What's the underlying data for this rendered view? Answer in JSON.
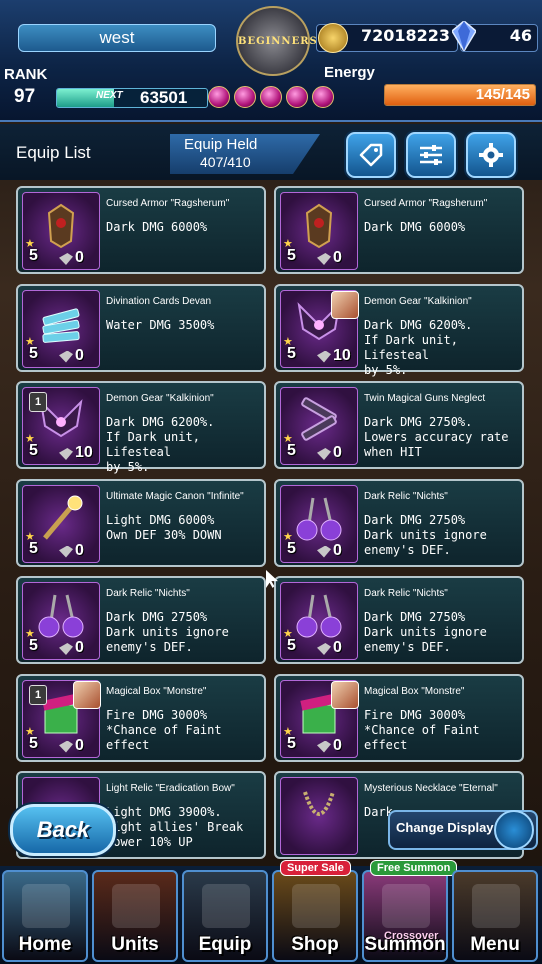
{
  "player": {
    "name": "west",
    "rank_label": "RANK",
    "rank": "97",
    "next_label": "NEXT",
    "next_exp": "63501",
    "exp_fraction": 0.38
  },
  "emblem": {
    "text": "BEGINNERS"
  },
  "currency": {
    "gold": "72018223",
    "gems": "46"
  },
  "energy": {
    "label": "Energy",
    "value": "145/145",
    "fraction": 1.0
  },
  "header": {
    "title": "Equip List",
    "held_label": "Equip Held",
    "held_value": "407/410",
    "buttons": [
      {
        "icon": "tag-icon"
      },
      {
        "icon": "filter-sliders-icon"
      },
      {
        "icon": "gear-icon"
      }
    ]
  },
  "cards": [
    {
      "name": "Cursed Armor \"Ragsherum\"",
      "desc": "Dark DMG 6000%",
      "level": "5",
      "count": "0",
      "art": "armor"
    },
    {
      "name": "Cursed Armor \"Ragsherum\"",
      "desc": "Dark DMG 6000%",
      "level": "5",
      "count": "0",
      "art": "armor"
    },
    {
      "name": "Divination Cards Devan",
      "desc": "Water DMG 3500%",
      "level": "5",
      "count": "0",
      "art": "cards"
    },
    {
      "name": "Demon Gear \"Kalkinion\"",
      "desc": "Dark DMG 6200%.\nIf Dark unit, Lifesteal\nby 5%.",
      "level": "5",
      "count": "10",
      "art": "wings",
      "portrait": true
    },
    {
      "name": "Demon Gear \"Kalkinion\"",
      "desc": "Dark DMG 6200%.\nIf Dark unit, Lifesteal\nby 5%.",
      "level": "5",
      "count": "10",
      "art": "wings",
      "badge": "1"
    },
    {
      "name": "Twin Magical Guns Neglect",
      "desc": "Dark DMG 2750%.\nLowers accuracy rate\nwhen HIT",
      "level": "5",
      "count": "0",
      "art": "guns"
    },
    {
      "name": "Ultimate Magic Canon \"Infinite\"",
      "desc": "Light DMG 6000%\nOwn DEF 30% DOWN",
      "level": "5",
      "count": "0",
      "art": "staff"
    },
    {
      "name": "Dark Relic \"Nichts\"",
      "desc": "Dark DMG 2750%\nDark units ignore\nenemy's DEF.",
      "level": "5",
      "count": "0",
      "art": "relic"
    },
    {
      "name": "Dark Relic \"Nichts\"",
      "desc": "Dark DMG 2750%\nDark units ignore\nenemy's DEF.",
      "level": "5",
      "count": "0",
      "art": "relic"
    },
    {
      "name": "Dark Relic \"Nichts\"",
      "desc": "Dark DMG 2750%\nDark units ignore\nenemy's DEF.",
      "level": "5",
      "count": "0",
      "art": "relic"
    },
    {
      "name": "Magical Box \"Monstre\"",
      "desc": "Fire DMG 3000%\n*Chance of Faint\neffect",
      "level": "5",
      "count": "0",
      "art": "box",
      "badge": "1",
      "portrait": true
    },
    {
      "name": "Magical Box \"Monstre\"",
      "desc": "Fire DMG 3000%\n*Chance of Faint\neffect",
      "level": "5",
      "count": "0",
      "art": "box",
      "portrait": true
    },
    {
      "name": "Light Relic \"Eradication Bow\"",
      "desc": "Light DMG 3900%.\nLight allies' Break\npower 10% UP",
      "level": "",
      "count": "",
      "art": "bow"
    },
    {
      "name": "Mysterious Necklace \"Eternal\"",
      "desc": "Dark",
      "level": "",
      "count": "",
      "art": "necklace"
    }
  ],
  "back_label": "Back",
  "change_display_label": "Change Display",
  "nav": [
    {
      "label": "Home",
      "bg": "#3a6a8a"
    },
    {
      "label": "Units",
      "bg": "#5a2a1a"
    },
    {
      "label": "Equip",
      "bg": "#2a3a4a"
    },
    {
      "label": "Shop",
      "bg": "#6a4a1a",
      "tag": "Super Sale",
      "tag_color": "#d8203a"
    },
    {
      "label": "Summon",
      "bg": "#8a3a7a",
      "tag": "Free Summon",
      "tag_color": "#2a9a3a",
      "extra": "Crossover"
    },
    {
      "label": "Menu",
      "bg": "#4a3a2a"
    }
  ]
}
